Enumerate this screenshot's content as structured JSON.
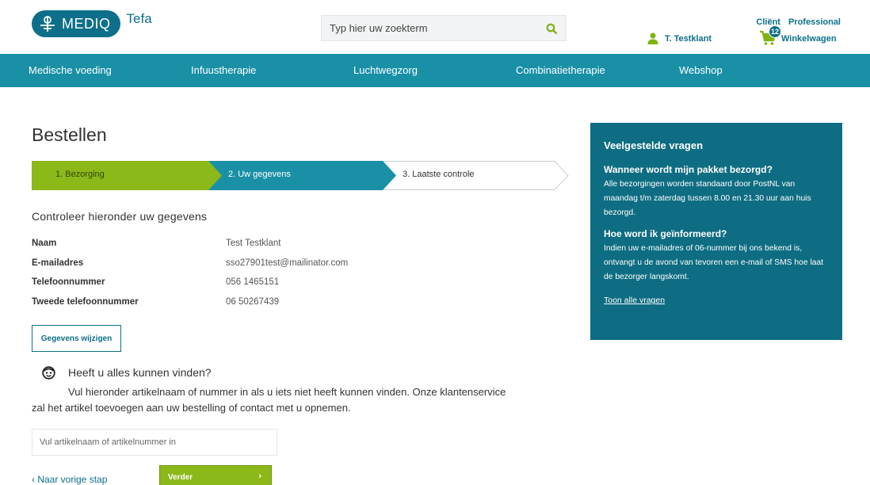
{
  "header": {
    "logo_text": "MEDIQ",
    "logo_sub": "Tefa",
    "search_placeholder": "Typ hier uw zoekterm",
    "top_links": [
      "Cliënt",
      "Professional"
    ],
    "user_name": "T. Testklant",
    "cart_count": "12",
    "cart_label": "Winkelwagen"
  },
  "nav": {
    "items": [
      "Medische voeding",
      "Infuustherapie",
      "Luchtwegzorg",
      "Combinatietherapie",
      "Webshop"
    ]
  },
  "main": {
    "title": "Bestellen",
    "steps": [
      "1. Bezorging",
      "2. Uw gegevens",
      "3. Laatste controle"
    ],
    "subtitle": "Controleer hieronder uw gegevens",
    "details": [
      {
        "label": "Naam",
        "value": "Test Testklant"
      },
      {
        "label": "E-mailadres",
        "value": "sso27901test@mailinator.com"
      },
      {
        "label": "Telefoonnummer",
        "value": "056 1465151"
      },
      {
        "label": "Tweede telefoonnummer",
        "value": "06 50267439"
      }
    ],
    "edit_button": "Gegevens wijzigen",
    "find_title": "Heeft u alles kunnen vinden?",
    "find_text": "Vul hieronder artikelnaam of nummer in als u iets niet heeft kunnen vinden. Onze klantenservice zal het artikel toevoegen aan uw bestelling of contact met u opnemen.",
    "article_placeholder": "Vul artikelnaam of artikelnummer in",
    "back_link": "‹ Naar vorige stap",
    "next_button": "Verder",
    "next_chevron": "›"
  },
  "faq": {
    "title": "Veelgestelde vragen",
    "items": [
      {
        "q": "Wanneer wordt mijn pakket bezorgd?",
        "a": "Alle bezorgingen worden standaard door PostNL van maandag t/m zaterdag tussen 8.00 en 21.30 uur aan huis bezorgd."
      },
      {
        "q": "Hoe word ik geïnformeerd?",
        "a": "Indien uw e-mailadres of 06-nummer bij ons bekend is, ontvangt u de avond van tevoren een e-mail of SMS hoe laat de bezorger langskomt."
      }
    ],
    "link": "Toon alle vragen"
  },
  "colors": {
    "brand": "#0d6f8a",
    "nav": "#1a90a6",
    "green": "#8cb81a",
    "faq_bg": "#0e6d82"
  },
  "icons": [
    "mediq-logo-icon",
    "search-icon",
    "user-icon",
    "cart-icon",
    "help-face-icon"
  ]
}
